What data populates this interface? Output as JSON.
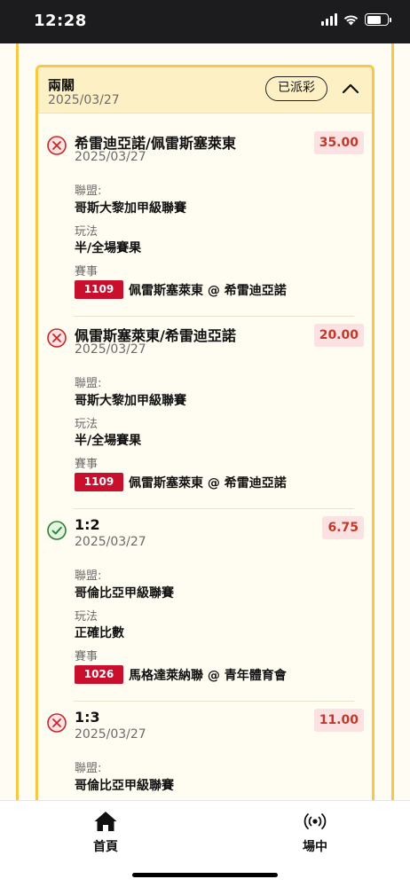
{
  "status_bar": {
    "time": "12:28"
  },
  "card": {
    "title": "兩關",
    "date": "2025/03/27",
    "badge": "已派彩"
  },
  "legs": [
    {
      "result": "lost",
      "selection": "希雷迪亞諾/佩雷斯塞萊東",
      "odds": "35.00",
      "date": "2025/03/27",
      "league_label": "聯盟:",
      "league": "哥斯大黎加甲級聯賽",
      "bet_type_label": "玩法",
      "bet_type": "半/全場賽果",
      "match_label": "賽事",
      "match_no": "1109",
      "match": "佩雷斯塞萊東 @ 希雷迪亞諾"
    },
    {
      "result": "lost",
      "selection": "佩雷斯塞萊東/希雷迪亞諾",
      "odds": "20.00",
      "date": "2025/03/27",
      "league_label": "聯盟:",
      "league": "哥斯大黎加甲級聯賽",
      "bet_type_label": "玩法",
      "bet_type": "半/全場賽果",
      "match_label": "賽事",
      "match_no": "1109",
      "match": "佩雷斯塞萊東 @ 希雷迪亞諾"
    },
    {
      "result": "won",
      "selection": "1:2",
      "odds": "6.75",
      "date": "2025/03/27",
      "league_label": "聯盟:",
      "league": "哥倫比亞甲級聯賽",
      "bet_type_label": "玩法",
      "bet_type": "正確比數",
      "match_label": "賽事",
      "match_no": "1026",
      "match": "馬格達萊納聯 @ 青年體育會"
    },
    {
      "result": "lost",
      "selection": "1:3",
      "odds": "11.00",
      "date": "2025/03/27",
      "league_label": "聯盟:",
      "league": "哥倫比亞甲級聯賽"
    }
  ],
  "tab_bar": {
    "home_label": "首頁",
    "home_icon": "home-icon",
    "live_label": "場中",
    "live_icon": "broadcast-icon"
  },
  "colors": {
    "accent_yellow": "#f6c945",
    "header_bg": "#fdf0c4",
    "lost_red": "#c0392b",
    "won_green": "#2e8b3a",
    "match_badge": "#c8102e"
  }
}
